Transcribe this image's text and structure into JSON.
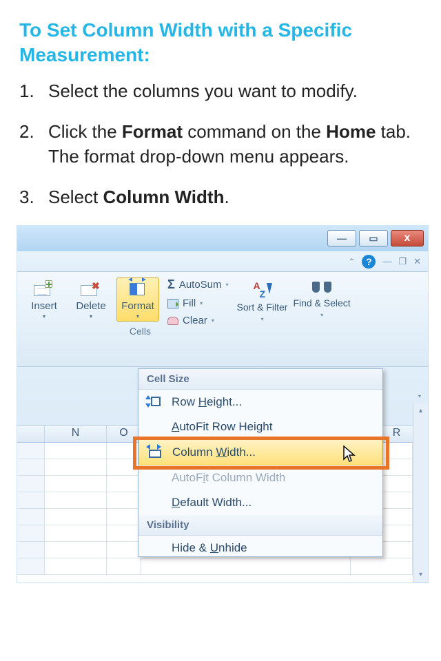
{
  "heading": "To Set Column Width with a Specific Measurement:",
  "steps": [
    {
      "num": "1.",
      "prefix": "Select the columns you want to modify."
    },
    {
      "num": "2.",
      "a": "Click the ",
      "b": "Format",
      "c": " command on the ",
      "d": "Home",
      "e": " tab. The format drop-down menu appears."
    },
    {
      "num": "3.",
      "a": "Select ",
      "b": "Column Width",
      "c": "."
    }
  ],
  "ribbon": {
    "insert": "Insert",
    "delete": "Delete",
    "format": "Format",
    "group_cells": "Cells",
    "autosum": "AutoSum",
    "fill": "Fill",
    "clear": "Clear",
    "sort_filter": "Sort & Filter",
    "find_select": "Find & Select"
  },
  "dropdown": {
    "section_cell_size": "Cell Size",
    "row_height": "Row Height...",
    "autofit_row": "AutoFit Row Height",
    "column_width": "Column Width...",
    "autofit_col": "AutoFit Column Width",
    "default_width": "Default Width...",
    "section_visibility": "Visibility",
    "hide_unhide": "Hide & Unhide"
  },
  "columns": {
    "n": "N",
    "o": "O",
    "r": "R"
  },
  "window": {
    "minimize": "—",
    "maximize": "▭",
    "close_x": "x"
  },
  "help": {
    "caret": "⌃",
    "q": "?",
    "min2": "—",
    "rest": "❐",
    "x2": "✕"
  }
}
